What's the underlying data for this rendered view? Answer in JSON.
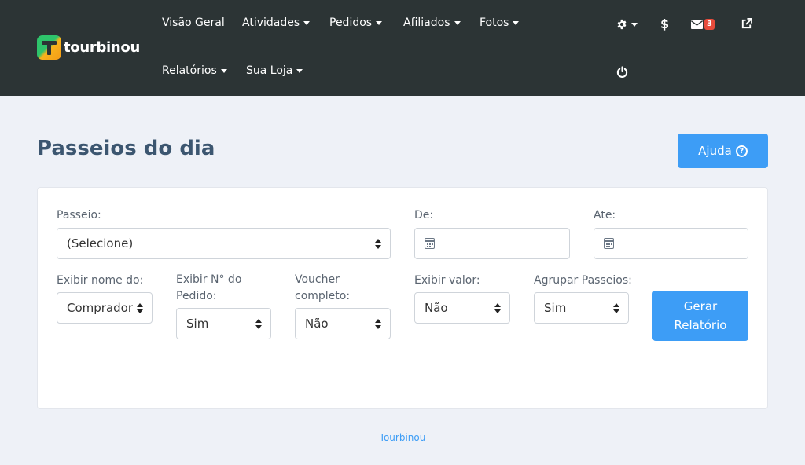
{
  "brand": {
    "name": "tourbinou"
  },
  "nav": {
    "items": [
      {
        "label": "Visão Geral",
        "dropdown": false
      },
      {
        "label": "Atividades",
        "dropdown": true
      },
      {
        "label": "Pedidos",
        "dropdown": true
      },
      {
        "label": "Afiliados",
        "dropdown": true
      },
      {
        "label": "Fotos",
        "dropdown": true
      },
      {
        "label": "Relatórios",
        "dropdown": true
      },
      {
        "label": "Sua Loja",
        "dropdown": true
      }
    ],
    "icons": {
      "settings": "gear-icon",
      "currency": "$",
      "messages_badge": "3",
      "external": "external-link-icon",
      "logout": "power-icon"
    }
  },
  "page": {
    "title": "Passeios do dia",
    "help_label": "Ajuda"
  },
  "form": {
    "passeio": {
      "label": "Passeio:",
      "value": "(Selecione)"
    },
    "de": {
      "label": "De:",
      "value": ""
    },
    "ate": {
      "label": "Ate:",
      "value": ""
    },
    "exibir_nome": {
      "label": "Exibir nome do:",
      "value": "Comprador"
    },
    "exibir_pedido": {
      "label": "Exibir N° do Pedido:",
      "value": "Sim"
    },
    "voucher": {
      "label": "Voucher completo:",
      "value": "Não"
    },
    "exibir_valor": {
      "label": "Exibir valor:",
      "value": "Não"
    },
    "agrupar": {
      "label": "Agrupar Passeios:",
      "value": "Sim"
    },
    "submit_label": "Gerar Relatório"
  },
  "footer": {
    "text": "Tourbinou"
  },
  "colors": {
    "header_bg": "#2c3435",
    "accent": "#3d9df6",
    "title": "#3c5670",
    "badge": "#e74c3c"
  }
}
